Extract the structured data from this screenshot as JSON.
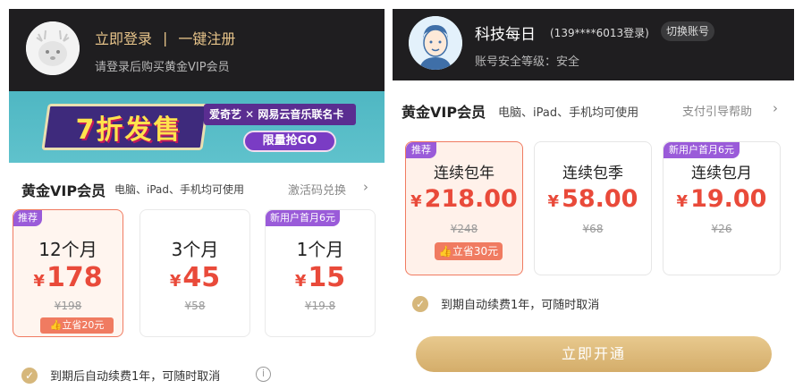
{
  "left": {
    "header": {
      "login_label": "立即登录",
      "separator": "|",
      "register_label": "一键注册",
      "hint": "请登录后购买黄金VIP会员"
    },
    "banner": {
      "title": "7折发售",
      "partner": "爱奇艺 ✕ 网易云音乐联名卡",
      "cta": "限量抢GO"
    },
    "section": {
      "title": "黄金VIP会员",
      "subtitle": "电脑、iPad、手机均可使用",
      "link": "激活码兑换",
      "link_arrow": "›"
    },
    "plans": [
      {
        "tag": "推荐",
        "duration": "12个月",
        "currency": "¥",
        "price": "178",
        "original": "¥198",
        "save": "立省20元",
        "selected": true
      },
      {
        "tag": "",
        "duration": "3个月",
        "currency": "¥",
        "price": "45",
        "original": "¥58",
        "save": "",
        "selected": false
      },
      {
        "tag": "新用户首月6元",
        "duration": "1个月",
        "currency": "¥",
        "price": "15",
        "original": "¥19.8",
        "save": "",
        "selected": false
      }
    ],
    "agreement": "到期后自动续费1年，可随时取消",
    "info_icon": "i"
  },
  "right": {
    "header": {
      "name": "科技每日",
      "account": "(139****6013登录)",
      "switch_label": "切换账号",
      "security": "账号安全等级：安全"
    },
    "section": {
      "title": "黄金VIP会员",
      "subtitle": "电脑、iPad、手机均可使用",
      "link": "支付引导帮助",
      "link_arrow": "›"
    },
    "plans": [
      {
        "tag": "推荐",
        "plan": "连续包年",
        "currency": "¥",
        "price": "218.00",
        "original": "¥248",
        "save": "立省30元",
        "selected": true
      },
      {
        "tag": "",
        "plan": "连续包季",
        "currency": "¥",
        "price": "58.00",
        "original": "¥68",
        "save": "",
        "selected": false
      },
      {
        "tag": "新用户首月6元",
        "plan": "连续包月",
        "currency": "¥",
        "price": "19.00",
        "original": "¥26",
        "save": "",
        "selected": false
      }
    ],
    "agreement": "到期自动续费1年，可随时取消",
    "cta": "立即开通"
  },
  "colors": {
    "header_bg": "#1f1e20",
    "gold": "#e7c48a",
    "price_red": "#e94a3a",
    "selected_border": "#f07b61",
    "tag_purple": "#9a5bd9",
    "cta_gold": "#d4ad6a"
  }
}
